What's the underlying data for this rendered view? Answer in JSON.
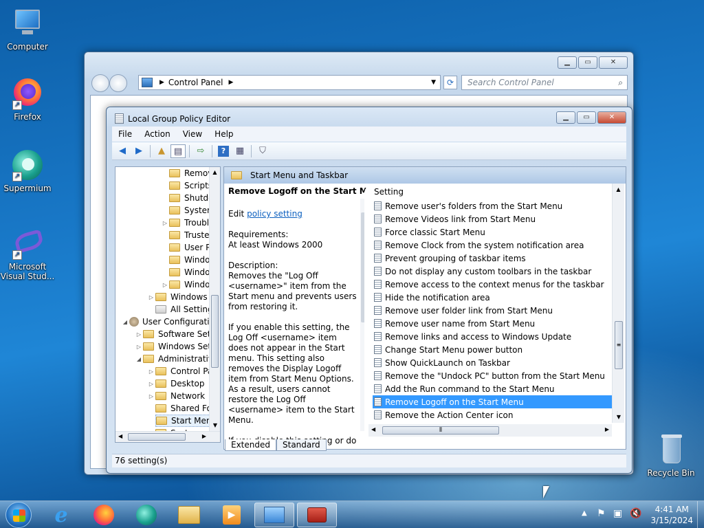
{
  "desktop": {
    "icons": [
      {
        "label": "Computer"
      },
      {
        "label": "Firefox"
      },
      {
        "label": "Supermium"
      },
      {
        "label": "Microsoft Visual Stud..."
      },
      {
        "label": "Recycle Bin"
      }
    ]
  },
  "control_panel": {
    "breadcrumb": "Control Panel",
    "search_placeholder": "Search Control Panel"
  },
  "gpe": {
    "title": "Local Group Policy Editor",
    "menu": [
      "File",
      "Action",
      "View",
      "Help"
    ],
    "tree": [
      "Remov",
      "Scripts",
      "Shutdo",
      "System",
      "Troubl",
      "Truste",
      "User Pr",
      "Windo",
      "Windo",
      "Windo",
      "Windows C",
      "All Setting",
      "User Configuration",
      "Software Setti",
      "Windows Sett",
      "Administrative",
      "Control Pa",
      "Desktop",
      "Network",
      "Shared Fol",
      "Start Menu",
      "System"
    ],
    "header": "Start Menu and Taskbar",
    "desc": {
      "title": "Remove Logoff on the Start Menu",
      "edit_prefix": "Edit",
      "edit_link": "policy setting",
      "req_label": "Requirements:",
      "req_value": "At least Windows 2000",
      "desc_label": "Description:",
      "p1": "Removes the \"Log Off <username>\" item from the Start menu and prevents users from restoring it.",
      "p2": "If you enable this setting, the Log Off <username> item does not appear in the Start menu. This setting also removes the Display Logoff item from Start Menu Options. As a result, users cannot restore the Log Off <username> item to the Start Menu.",
      "p3": "If you disable this setting or do not configure it, users can use the"
    },
    "column_header": "Setting",
    "settings": [
      "Remove user's folders from the Start Menu",
      "Remove Videos link from Start Menu",
      "Force classic Start Menu",
      "Remove Clock from the system notification area",
      "Prevent grouping of taskbar items",
      "Do not display any custom toolbars in the taskbar",
      "Remove access to the context menus for the taskbar",
      "Hide the notification area",
      "Remove user folder link from Start Menu",
      "Remove user name from Start Menu",
      "Remove links and access to Windows Update",
      "Change Start Menu power button",
      "Show QuickLaunch on Taskbar",
      "Remove the \"Undock PC\" button from the Start Menu",
      "Add the Run command to the Start Menu",
      "Remove Logoff on the Start Menu",
      "Remove the Action Center icon"
    ],
    "tabs": [
      "Extended",
      "Standard"
    ],
    "status": "76 setting(s)"
  },
  "clock": {
    "time": "4:41 AM",
    "date": "3/15/2024"
  }
}
